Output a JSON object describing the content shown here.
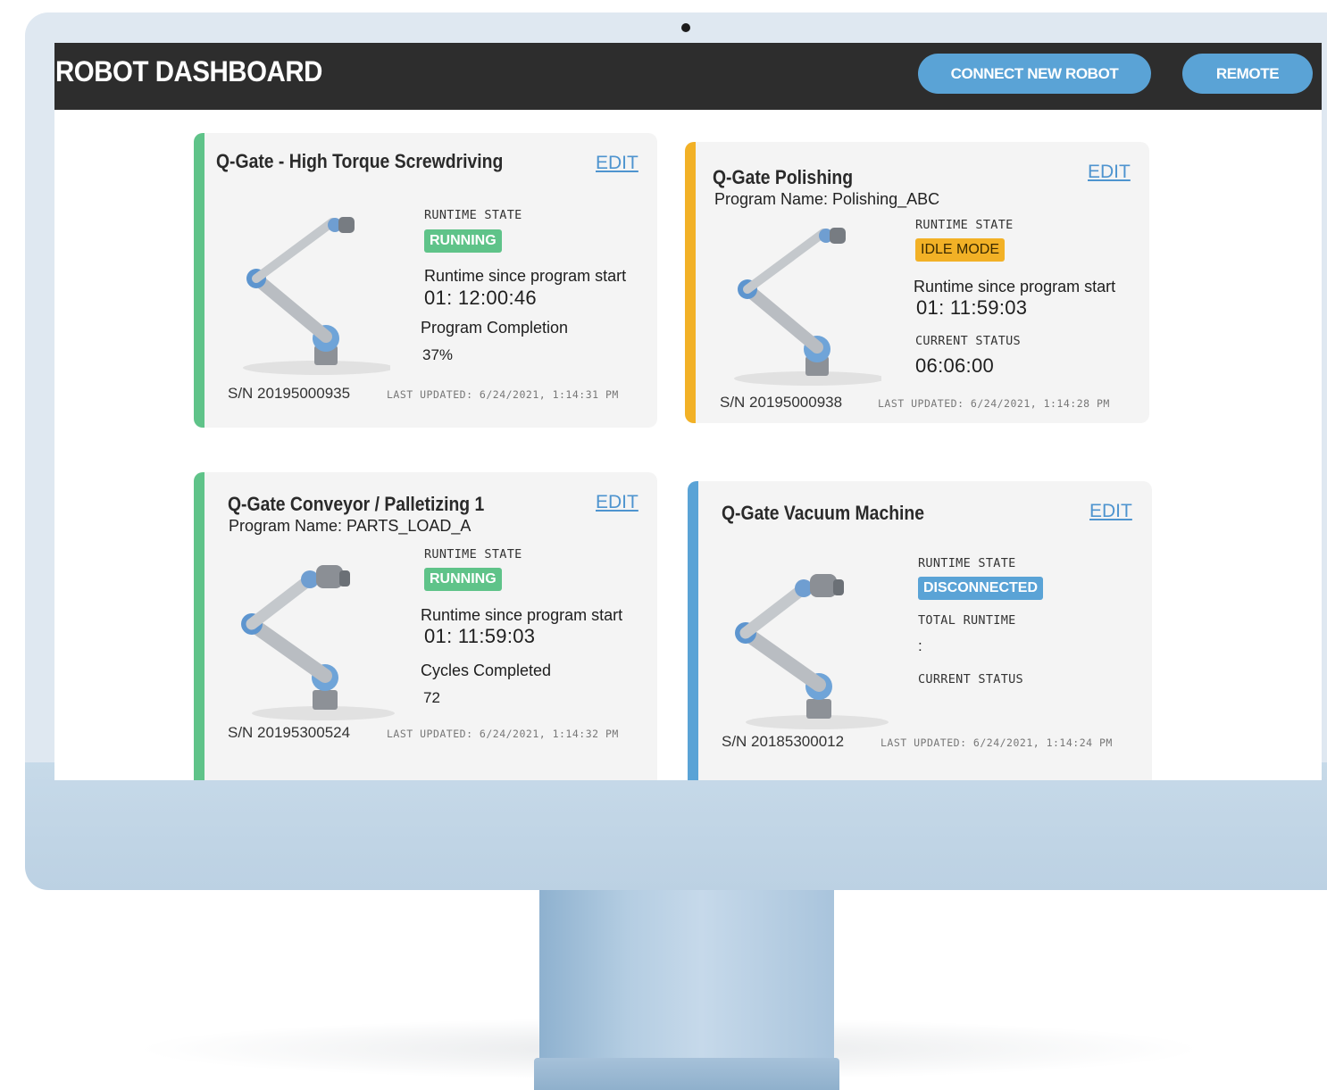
{
  "header": {
    "title": "ROBOT DASHBOARD",
    "connect_label": "CONNECT NEW ROBOT",
    "remote_label": "REMOTE"
  },
  "colors": {
    "topbar": "#2d2d2d",
    "button": "#5aa3d6",
    "running": "#5fc389",
    "idle": "#f2b126",
    "disconnected": "#5aa3d6"
  },
  "edit_label": "EDIT",
  "robots": [
    {
      "name": "Q-Gate - High Torque Screwdriving",
      "program": "",
      "state_label": "RUNTIME STATE",
      "state": "RUNNING",
      "runtime_label": "Runtime since program start",
      "runtime": "01: 12:00:46",
      "metric_label": "Program Completion",
      "metric_value": "37%",
      "serial": "S/N 20195000935",
      "updated": "LAST UPDATED: 6/24/2021, 1:14:31 PM",
      "status_color": "#5fc389"
    },
    {
      "name": "Q-Gate Polishing",
      "program": "Program Name: Polishing_ABC",
      "state_label": "RUNTIME STATE",
      "state": "IDLE MODE",
      "runtime_label": "Runtime since program start",
      "runtime": "01: 11:59:03",
      "metric_label": "CURRENT STATUS",
      "metric_value": "06:06:00",
      "serial": "S/N 20195000938",
      "updated": "LAST UPDATED: 6/24/2021, 1:14:28 PM",
      "status_color": "#f2b126"
    },
    {
      "name": "Q-Gate Conveyor / Palletizing 1",
      "program": "Program Name: PARTS_LOAD_A",
      "state_label": "RUNTIME STATE",
      "state": "RUNNING",
      "runtime_label": "Runtime since program start",
      "runtime": "01: 11:59:03",
      "metric_label": "Cycles Completed",
      "metric_value": "72",
      "serial": "S/N 20195300524",
      "updated": "LAST UPDATED: 6/24/2021, 1:14:32 PM",
      "status_color": "#5fc389"
    },
    {
      "name": "Q-Gate Vacuum Machine",
      "program": "",
      "state_label": "RUNTIME STATE",
      "state": "DISCONNECTED",
      "runtime_label": "TOTAL RUNTIME",
      "runtime": ":",
      "metric_label": "CURRENT STATUS",
      "metric_value": "",
      "serial": "S/N 20185300012",
      "updated": "LAST UPDATED: 6/24/2021, 1:14:24 PM",
      "status_color": "#5aa3d6"
    }
  ]
}
